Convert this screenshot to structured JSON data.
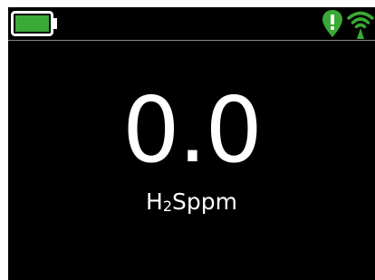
{
  "status_bar": {
    "battery": {
      "icon": "battery-icon",
      "level": 1.0,
      "color": "#3aa935"
    },
    "alarm": {
      "icon": "alarm-icon",
      "color": "#3aa935"
    },
    "wireless": {
      "icon": "wireless-icon",
      "color": "#3aa935"
    }
  },
  "main": {
    "reading": "0.0",
    "unit_prefix": "H",
    "unit_subscript": "2",
    "unit_suffix": "Sppm"
  }
}
